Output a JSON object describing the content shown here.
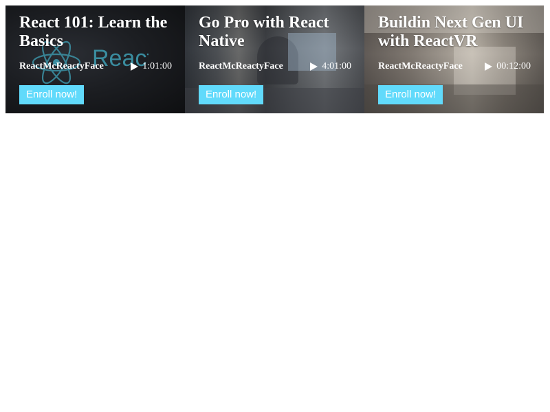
{
  "courses": [
    {
      "title": "React 101: Learn the Basics",
      "author": "ReactMcReactyFace",
      "duration": "1:01:00",
      "enroll_label": "Enroll now!",
      "background_text": "React"
    },
    {
      "title": "Go Pro with React Native",
      "author": "ReactMcReactyFace",
      "duration": "4:01:00",
      "enroll_label": "Enroll now!"
    },
    {
      "title": "Buildin Next Gen UI with ReactVR",
      "author": "ReactMcReactyFace",
      "duration": "00:12:00",
      "enroll_label": "Enroll now!"
    }
  ],
  "colors": {
    "accent": "#61dafb",
    "text": "#ffffff",
    "page_background": "#ffffff"
  },
  "icons": {
    "play": "play-icon",
    "react_logo": "react-logo-icon"
  }
}
